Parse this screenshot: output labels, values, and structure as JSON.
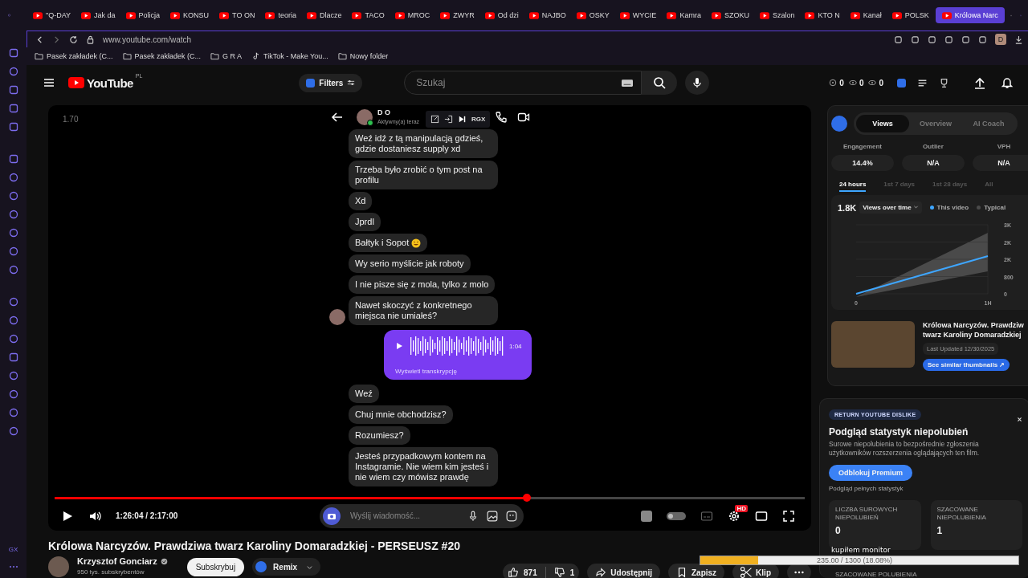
{
  "browser": {
    "tabs": [
      {
        "label": "\"Q-DAY",
        "selected": false
      },
      {
        "label": "Jak da",
        "selected": false
      },
      {
        "label": "Policja",
        "selected": false
      },
      {
        "label": "KONSU",
        "selected": false
      },
      {
        "label": "TO ON",
        "selected": false
      },
      {
        "label": "teoria",
        "selected": false
      },
      {
        "label": "Dlacze",
        "selected": false
      },
      {
        "label": "TACO",
        "selected": false
      },
      {
        "label": "MROC",
        "selected": false
      },
      {
        "label": "ZWYR",
        "selected": false
      },
      {
        "label": "Od dzi",
        "selected": false
      },
      {
        "label": "NAJBO",
        "selected": false
      },
      {
        "label": "OSKY",
        "selected": false
      },
      {
        "label": "WYCIE",
        "selected": false
      },
      {
        "label": "Kamra",
        "selected": false
      },
      {
        "label": "SZOKU",
        "selected": false
      },
      {
        "label": "Szalon",
        "selected": false
      },
      {
        "label": "KTO N",
        "selected": false
      },
      {
        "label": "Kanał",
        "selected": false
      },
      {
        "label": "POLSK",
        "selected": false
      },
      {
        "label": "Królowa Narc",
        "selected": true
      }
    ],
    "address": "www.youtube.com/watch",
    "bookmarks": [
      {
        "label": "Pasek zakładek (C...",
        "kind": "folder"
      },
      {
        "label": "Pasek zakładek (C...",
        "kind": "folder"
      },
      {
        "label": "G R A",
        "kind": "folder"
      },
      {
        "label": "TikTok - Make You...",
        "kind": "tiktok"
      },
      {
        "label": "Nowy folder",
        "kind": "folder"
      }
    ],
    "profile_initial": "D",
    "sidebar_label": "GX"
  },
  "header": {
    "logo": "YouTube",
    "region": "PL",
    "filters": "Filters",
    "search": {
      "placeholder": "Szukaj"
    },
    "stats": [
      "0",
      "0",
      "0"
    ]
  },
  "player": {
    "speed": "1.70",
    "chat": {
      "name": "D O",
      "status": "Aktywny(a) teraz",
      "overlay_label": "RGX",
      "messages": [
        {
          "kind": "text",
          "text": "Weź idź z tą manipulacją gdzieś, gdzie dostaniesz supply xd",
          "avatar": false,
          "emoji": false
        },
        {
          "kind": "text",
          "text": "Trzeba było zrobić o tym post na profilu",
          "avatar": false,
          "emoji": false
        },
        {
          "kind": "text",
          "text": "Xd",
          "avatar": false,
          "emoji": false
        },
        {
          "kind": "text",
          "text": "Jprdl",
          "avatar": false,
          "emoji": false
        },
        {
          "kind": "text",
          "text": "Bałtyk i Sopot",
          "avatar": false,
          "emoji": true
        },
        {
          "kind": "text",
          "text": "Wy serio myślicie jak roboty",
          "avatar": false,
          "emoji": false
        },
        {
          "kind": "text",
          "text": "I nie pisze się z mola, tylko z molo",
          "avatar": false,
          "emoji": false
        },
        {
          "kind": "text",
          "text": "Nawet skoczyć z konkretnego miejsca nie umiałeś?",
          "avatar": true,
          "emoji": false
        },
        {
          "kind": "voice",
          "duration": "1:04",
          "link": "Wyświetl transkrypcję"
        },
        {
          "kind": "text",
          "text": "Weź",
          "avatar": false,
          "emoji": false
        },
        {
          "kind": "text",
          "text": "Chuj mnie obchodzisz?",
          "avatar": false,
          "emoji": false
        },
        {
          "kind": "text",
          "text": "Rozumiesz?",
          "avatar": false,
          "emoji": false
        },
        {
          "kind": "text",
          "text": "Jesteś przypadkowym kontem na Instagramie. Nie wiem kim jesteś i nie wiem czy mówisz prawdę",
          "avatar": false,
          "emoji": false
        }
      ],
      "input": {
        "placeholder": "Wyślij wiadomość..."
      }
    },
    "progress": {
      "level": 0.63
    },
    "autoplay": false,
    "time": "1:26:04 / 2:17:00",
    "hd_badge": "HD"
  },
  "video": {
    "title": "Królowa Narcyzów. Prawdziwa twarz Karoliny Domaradzkiej - PERSEUSZ #20",
    "channel": "Krzysztof Gonciarz",
    "subscribers": "950 tys. subskrybentów",
    "subscribe": "Subskrybuj",
    "remix": "Remix",
    "likes": "871",
    "dislikes": "1",
    "share": "Udostępnij",
    "save": "Zapisz",
    "clip": "Klip"
  },
  "analytics": {
    "tabs": [
      {
        "label": "Views",
        "selected": true
      },
      {
        "label": "Overview",
        "selected": false
      },
      {
        "label": "AI Coach",
        "selected": false
      }
    ],
    "metrics": [
      {
        "label": "Engagement",
        "value": "14.4%"
      },
      {
        "label": "Outlier",
        "value": "N/A"
      },
      {
        "label": "VPH",
        "value": "N/A"
      }
    ],
    "ranges": [
      {
        "label": "24 hours",
        "selected": true
      },
      {
        "label": "1st 7 days",
        "selected": false
      },
      {
        "label": "1st 28 days",
        "selected": false
      },
      {
        "label": "All",
        "selected": false
      }
    ],
    "total": "1.8K",
    "dropdown": "Views over time",
    "chart_data": {
      "type": "line",
      "grid": true,
      "x": [
        0,
        1
      ],
      "xlim": [
        0,
        1
      ],
      "xticks": [
        {
          "value": 0,
          "label": "0"
        },
        {
          "value": 1,
          "label": "1H"
        }
      ],
      "ylim": [
        0,
        3200
      ],
      "yticks": [
        {
          "value": 0,
          "label": "0"
        },
        {
          "value": 800,
          "label": "800"
        },
        {
          "value": 1600,
          "label": "2K"
        },
        {
          "value": 2400,
          "label": "2K"
        },
        {
          "value": 3200,
          "label": "3K"
        }
      ],
      "series": [
        {
          "name": "This video",
          "color": "#3ea6ff",
          "values": [
            0,
            1750
          ]
        }
      ]
    },
    "typical_legend": {
      "label": "Typical",
      "color": "#4a4a4a"
    },
    "thumbnail": {
      "title_lines": [
        "Królowa Narcyzów. Prawdziw",
        "twarz Karoliny Domaradzkiej"
      ],
      "updated": "Last Updated 12/30/2025",
      "button": "See similar thumbnails ↗"
    }
  },
  "dislikes": {
    "badge": "RETURN YOUTUBE DISLIKE",
    "title": "Podgląd statystyk niepolubień",
    "description": "Surowe niepolubienia to bezpośrednie zgłoszenia użytkowników rozszerzenia oglądających ten film.",
    "button": "Odblokuj Premium",
    "note": "Podgląd pełnych statystyk",
    "stats": [
      {
        "label": "LICZBA SUROWYCH NIEPOLUBIEŃ",
        "value": "0"
      },
      {
        "label": "SZACOWANE NIEPOLUBIENIA",
        "value": "1"
      }
    ],
    "next_label": "SZACOWANE POLUBIENIA"
  },
  "stream_overlay": {
    "caption": "kupiłem monitor",
    "goal": "235.00 / 1300 (18.08%)",
    "level": 0.1808
  }
}
